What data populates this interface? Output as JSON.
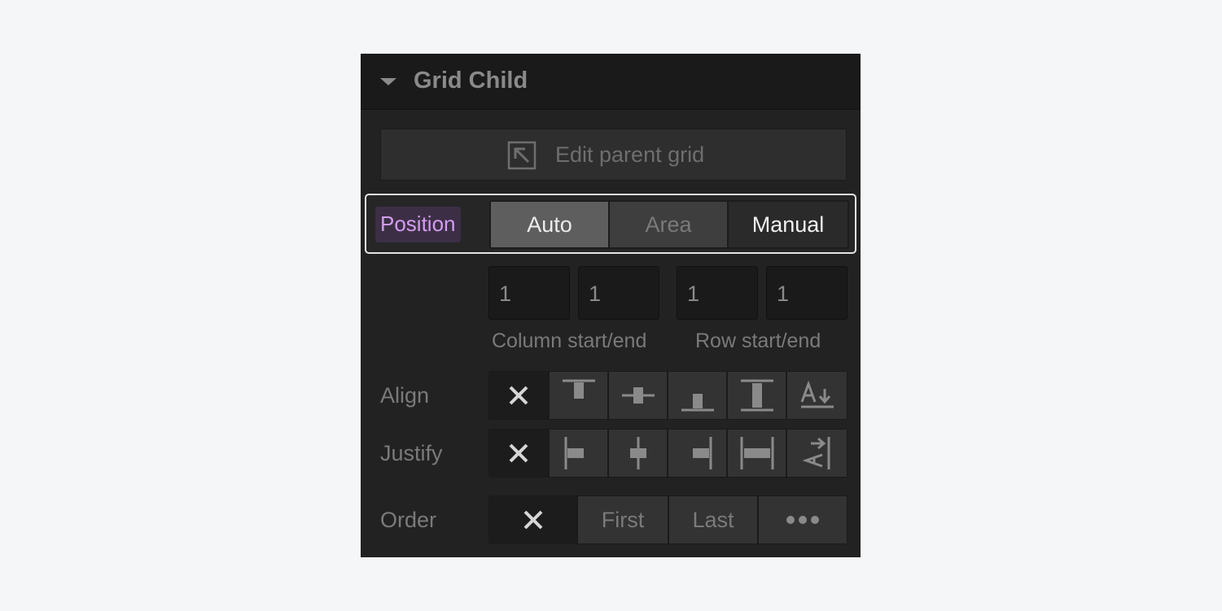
{
  "panel": {
    "title": "Grid Child"
  },
  "edit_parent": {
    "label": "Edit parent grid"
  },
  "position": {
    "label": "Position",
    "options": [
      "Auto",
      "Area",
      "Manual"
    ],
    "selected": "Manual"
  },
  "placement": {
    "column_start": "1",
    "column_end": "1",
    "row_start": "1",
    "row_end": "1",
    "column_label": "Column start/end",
    "row_label": "Row start/end"
  },
  "align": {
    "label": "Align",
    "options": [
      "none-icon",
      "align-start-icon",
      "align-center-icon",
      "align-end-icon",
      "align-stretch-icon",
      "align-baseline-icon"
    ],
    "selected": "none-icon"
  },
  "justify": {
    "label": "Justify",
    "options": [
      "none-icon",
      "justify-start-icon",
      "justify-center-icon",
      "justify-end-icon",
      "justify-stretch-icon",
      "justify-baseline-icon"
    ],
    "selected": "none-icon"
  },
  "order": {
    "label": "Order",
    "options": [
      "First",
      "Last"
    ],
    "selected": "none-icon"
  },
  "colors": {
    "panel_bg": "#222222",
    "header_bg": "#1a1a1a",
    "position_label_fg": "#d49cf1",
    "position_label_bg": "#3c2f45",
    "highlight_border": "#e4e4e4"
  }
}
